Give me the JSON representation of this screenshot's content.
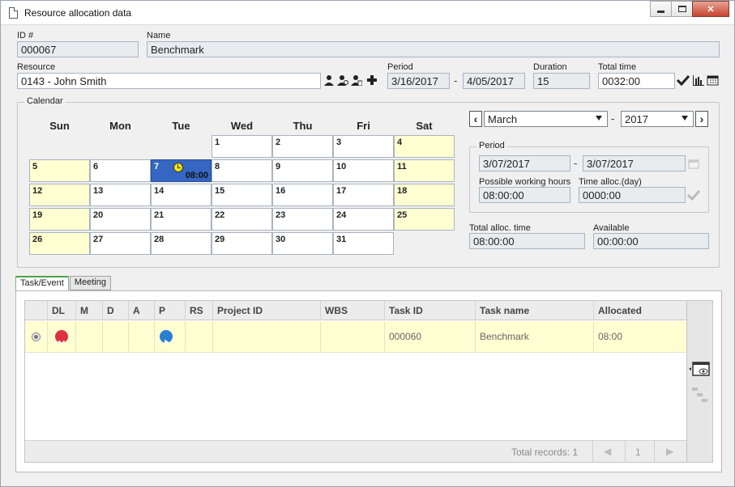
{
  "window": {
    "title": "Resource allocation data"
  },
  "id_field": {
    "label": "ID #",
    "value": "000067"
  },
  "name_field": {
    "label": "Name",
    "value": "Benchmark"
  },
  "resource": {
    "label": "Resource",
    "value": "0143 - John Smith"
  },
  "period": {
    "label": "Period",
    "start": "3/16/2017",
    "separator": "-",
    "end": "4/05/2017"
  },
  "duration": {
    "label": "Duration",
    "value": "15"
  },
  "total_time": {
    "label": "Total time",
    "value": "0032:00"
  },
  "calendar": {
    "legend": "Calendar",
    "days": [
      "Sun",
      "Mon",
      "Tue",
      "Wed",
      "Thu",
      "Fri",
      "Sat"
    ],
    "weeks": [
      [
        "",
        "",
        "",
        "1",
        "2",
        "3",
        "4"
      ],
      [
        "5",
        "6",
        "7",
        "8",
        "9",
        "10",
        "11"
      ],
      [
        "12",
        "13",
        "14",
        "15",
        "16",
        "17",
        "18"
      ],
      [
        "19",
        "20",
        "21",
        "22",
        "23",
        "24",
        "25"
      ],
      [
        "26",
        "27",
        "28",
        "29",
        "30",
        "31",
        ""
      ]
    ],
    "selected_day": "7",
    "selected_hours": "08:00",
    "colors": {
      "weekend": "#ffffd2",
      "selected": "#3466c2"
    }
  },
  "month_nav": {
    "month": "March",
    "separator": "-",
    "year": "2017"
  },
  "right_period": {
    "legend": "Period",
    "start": "3/07/2017",
    "separator": "-",
    "end": "3/07/2017",
    "possible_label": "Possible working hours",
    "possible_value": "08:00:00",
    "alloc_label": "Time alloc.(day)",
    "alloc_value": "0000:00"
  },
  "totals": {
    "total_alloc_label": "Total alloc. time",
    "total_alloc_value": "08:00:00",
    "available_label": "Available",
    "available_value": "00:00:00"
  },
  "tabs": [
    "Task/Event",
    "Meeting"
  ],
  "table": {
    "columns": [
      "DL",
      "M",
      "D",
      "A",
      "P",
      "RS",
      "Project ID",
      "WBS",
      "Task ID",
      "Task name",
      "Allocated"
    ],
    "rows": [
      {
        "project_id": "",
        "wbs": "",
        "task_id": "000060",
        "task_name": "Benchmark",
        "allocated": "08:00"
      }
    ],
    "footer": {
      "total_records": "Total records: 1",
      "page": "1"
    },
    "colors": {
      "row": "#ffffd2",
      "dl_icon": "#e03040",
      "p_icon": "#2a7fd4"
    }
  }
}
